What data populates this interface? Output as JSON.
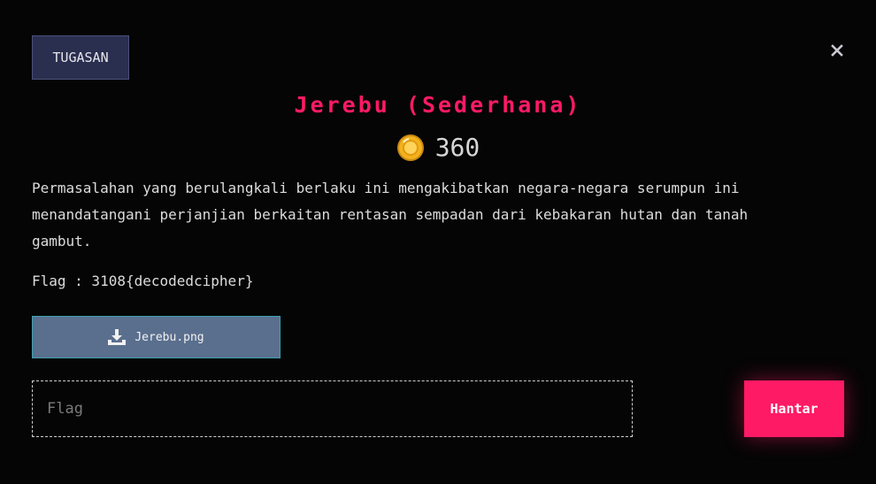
{
  "header": {
    "category_label": "TUGASAN",
    "close_icon": "close-icon"
  },
  "challenge": {
    "title": "Jerebu (Sederhana)",
    "points": "360",
    "points_icon": "coin-icon",
    "description": "Permasalahan yang berulangkali berlaku ini mengakibatkan negara-negara serumpun ini menandatangani perjanjian berkaitan rentasan sempadan dari kebakaran hutan dan tanah gambut.",
    "flag_hint": "Flag : 3108{decodedcipher}"
  },
  "attachment": {
    "file_name": "Jerebu.png",
    "icon": "download-icon"
  },
  "submission": {
    "flag_placeholder": "Flag",
    "flag_value": "",
    "submit_label": "Hantar"
  },
  "colors": {
    "accent": "#ff1a66",
    "background": "#050505",
    "tag_bg": "#2b2f4f",
    "download_bg": "#5a6f8e"
  }
}
